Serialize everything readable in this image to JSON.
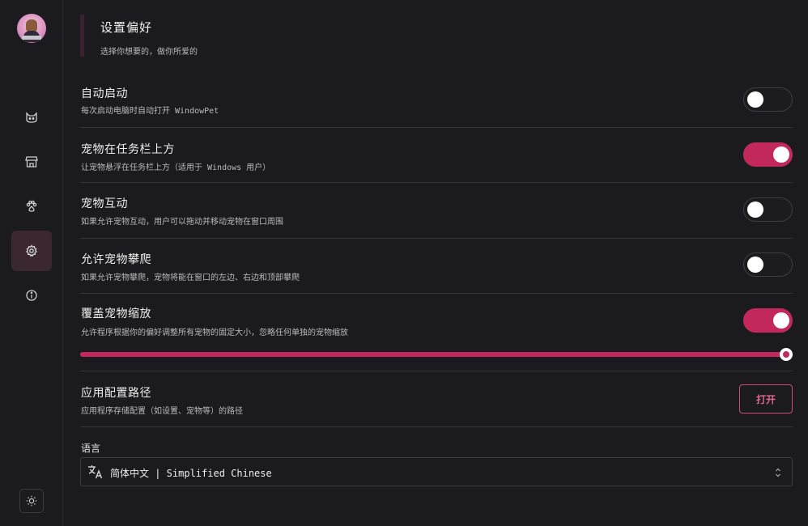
{
  "sidebar": {
    "avatar_icon": "pet-avatar",
    "items": [
      {
        "icon": "cat-icon",
        "active": false
      },
      {
        "icon": "store-icon",
        "active": false
      },
      {
        "icon": "paw-icon",
        "active": false
      },
      {
        "icon": "gear-icon",
        "active": true
      },
      {
        "icon": "info-icon",
        "active": false
      }
    ],
    "theme_icon": "sun-icon"
  },
  "header": {
    "title": "设置偏好",
    "subtitle": "选择你想要的，做你所爱的"
  },
  "settings": [
    {
      "title": "自动启动",
      "description": "每次启动电脑时自动打开 WindowPet",
      "enabled": false
    },
    {
      "title": "宠物在任务栏上方",
      "description": "让宠物悬浮在任务栏上方（适用于 Windows 用户）",
      "enabled": true
    },
    {
      "title": "宠物互动",
      "description": "如果允许宠物互动，用户可以拖动并移动宠物在窗口周围",
      "enabled": false
    },
    {
      "title": "允许宠物攀爬",
      "description": "如果允许宠物攀爬，宠物将能在窗口的左边、右边和顶部攀爬",
      "enabled": false
    },
    {
      "title": "覆盖宠物缩放",
      "description": "允许程序根据你的偏好调整所有宠物的固定大小，忽略任何单独的宠物缩放",
      "enabled": true
    }
  ],
  "scale_slider": {
    "value_fraction": 1.0
  },
  "config_path": {
    "title": "应用配置路径",
    "description": "应用程序存储配置（如设置、宠物等）的路径",
    "button_label": "打开"
  },
  "language": {
    "label": "语言",
    "selected": "简体中文 | Simplified Chinese"
  },
  "colors": {
    "accent": "#c2285c",
    "background": "#1b1b1f",
    "active_nav": "#3a2731"
  }
}
